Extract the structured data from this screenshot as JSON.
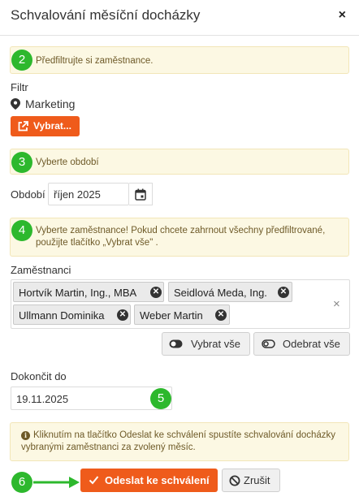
{
  "header": {
    "title": "Schvalování měsíční docházky",
    "close_label": "×"
  },
  "steps": {
    "s2": "2",
    "s3": "3",
    "s4": "4",
    "s5": "5",
    "s6": "6"
  },
  "filter": {
    "info": "Předfiltrujte si zaměstnance.",
    "label": "Filtr",
    "value": "Marketing",
    "select_button": "Vybrat..."
  },
  "period": {
    "info": "Vyberte období",
    "label": "Období",
    "value": "říjen 2025"
  },
  "employees": {
    "info": "Vyberte zaměstnance! Pokud chcete zahrnout všechny předfiltrované, použijte tlačítko „Vybrat vše\" .",
    "label": "Zaměstnanci",
    "selected": [
      "Hortvík Martin, Ing., MBA",
      "Seidlová Meda, Ing.",
      "Ullmann Dominika",
      "Weber Martin"
    ],
    "clear_label": "×",
    "select_all": "Vybrat vše",
    "remove_all": "Odebrat vše"
  },
  "deadline": {
    "label": "Dokončit do",
    "value": "19.11.2025"
  },
  "submit_info": "Kliknutím na tlačítko Odeslat ke schválení spustíte schvalování docházky vybranými zaměstnanci za zvolený měsíc.",
  "actions": {
    "submit": "Odeslat ke schválení",
    "cancel": "Zrušit"
  },
  "colors": {
    "accent": "#ef5b1b",
    "step": "#2db82d",
    "info_bg": "#fcf8e3"
  }
}
